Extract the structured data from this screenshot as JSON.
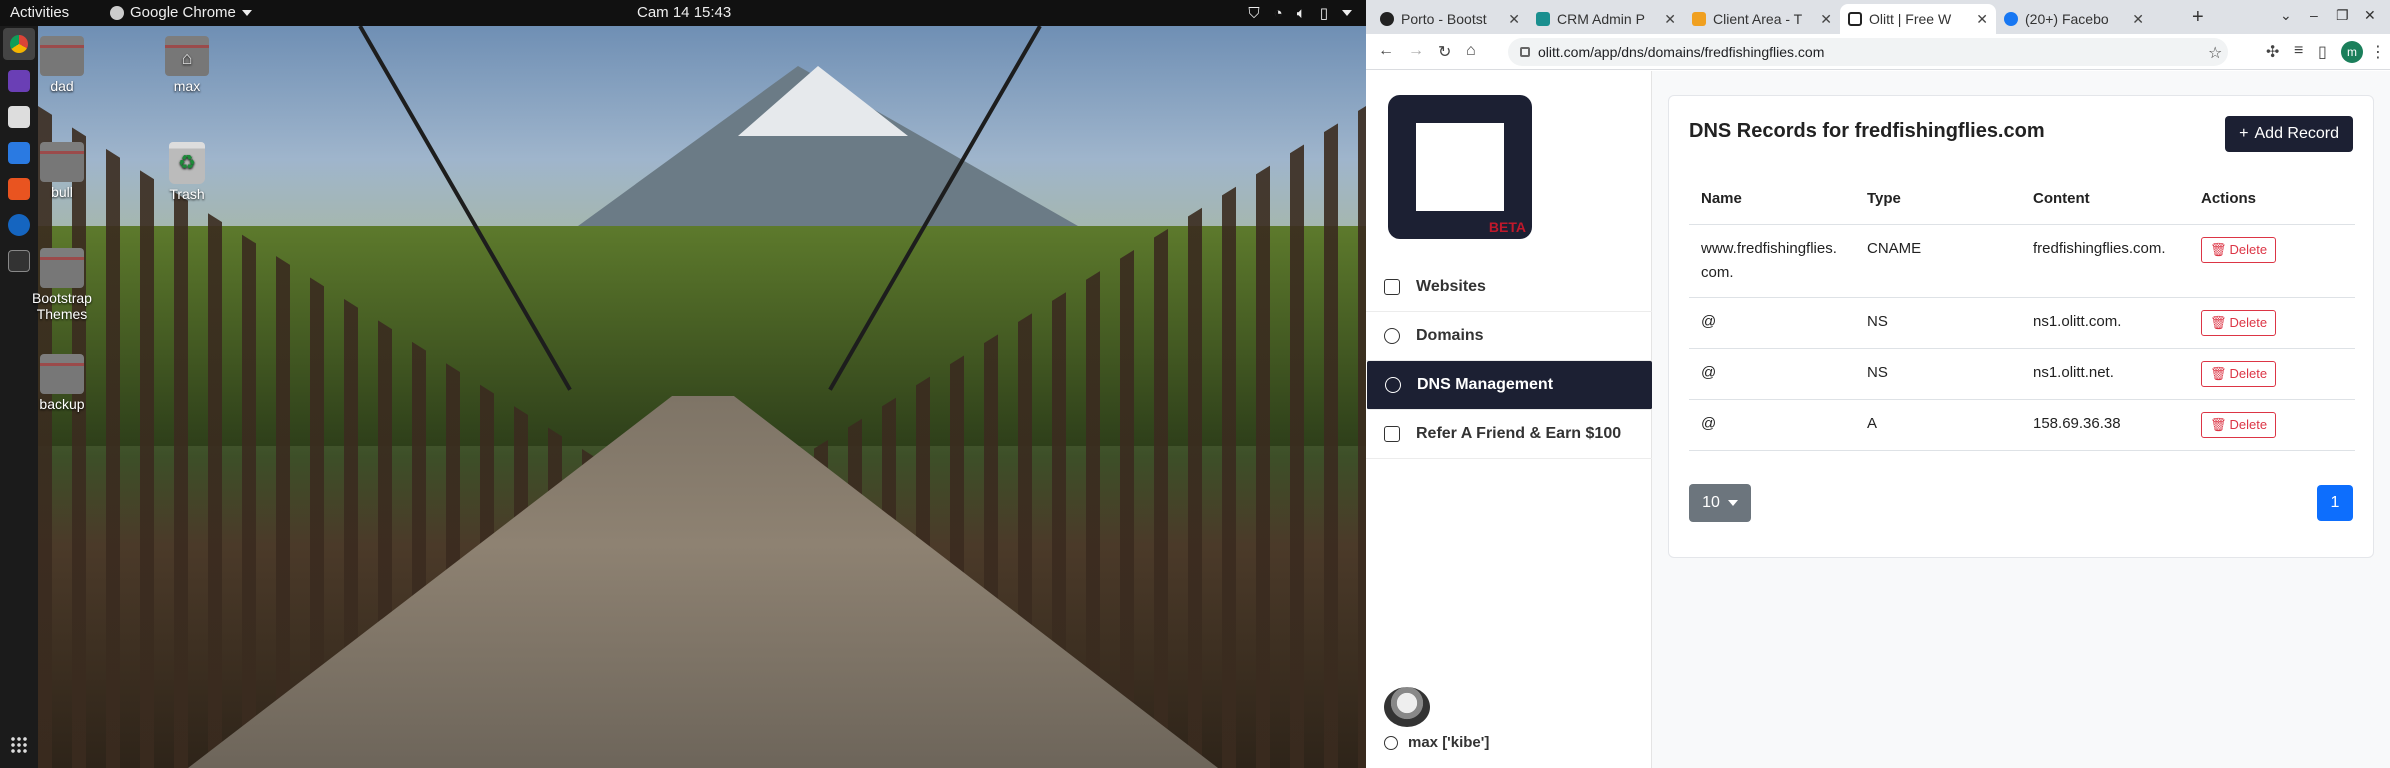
{
  "topbar": {
    "activities": "Activities",
    "app_name": "Google Chrome",
    "clock": "Cam 14  15:43"
  },
  "desktop_icons": [
    {
      "label": "dad"
    },
    {
      "label": "max"
    },
    {
      "label": "bull"
    },
    {
      "label": "Trash"
    },
    {
      "label": "Bootstrap Themes"
    },
    {
      "label": "backup"
    }
  ],
  "browser": {
    "tabs": [
      {
        "title": "Porto - Bootst",
        "icon_color": "#222222"
      },
      {
        "title": "CRM Admin P",
        "icon_color": "#1a8f8f"
      },
      {
        "title": "Client Area - T",
        "icon_color": "#f0a020"
      },
      {
        "title": "Olitt | Free W",
        "icon_color": "#222222",
        "active": true
      },
      {
        "title": "(20+) Facebo",
        "icon_color": "#1877f2"
      }
    ],
    "url": "olitt.com/app/dns/domains/fredfishingflies.com",
    "profile_initial": "m"
  },
  "sidebar": {
    "badge": "BETA",
    "items": [
      {
        "label": "Websites",
        "icon": "briefcase-icon"
      },
      {
        "label": "Domains",
        "icon": "globe-icon"
      },
      {
        "label": "DNS Management",
        "icon": "compass-icon",
        "active": true
      },
      {
        "label": "Refer A Friend & Earn $100",
        "icon": "cash-icon"
      }
    ],
    "user": "max ['kibe']"
  },
  "dns": {
    "title": "DNS Records for fredfishingflies.com",
    "add_label": "Add Record",
    "columns": [
      "Name",
      "Type",
      "Content",
      "Actions"
    ],
    "rows": [
      {
        "name": "www.fredfishingflies.com.",
        "type": "CNAME",
        "content": "fredfishingflies.com.",
        "action": "Delete"
      },
      {
        "name": "@",
        "type": "NS",
        "content": "ns1.olitt.com.",
        "action": "Delete"
      },
      {
        "name": "@",
        "type": "NS",
        "content": "ns1.olitt.net.",
        "action": "Delete"
      },
      {
        "name": "@",
        "type": "A",
        "content": "158.69.36.38",
        "action": "Delete"
      }
    ],
    "per_page": "10",
    "current_page": "1"
  },
  "colors": {
    "brand_dark": "#1c2033",
    "danger": "#dc3545",
    "primary": "#0d6efd"
  }
}
